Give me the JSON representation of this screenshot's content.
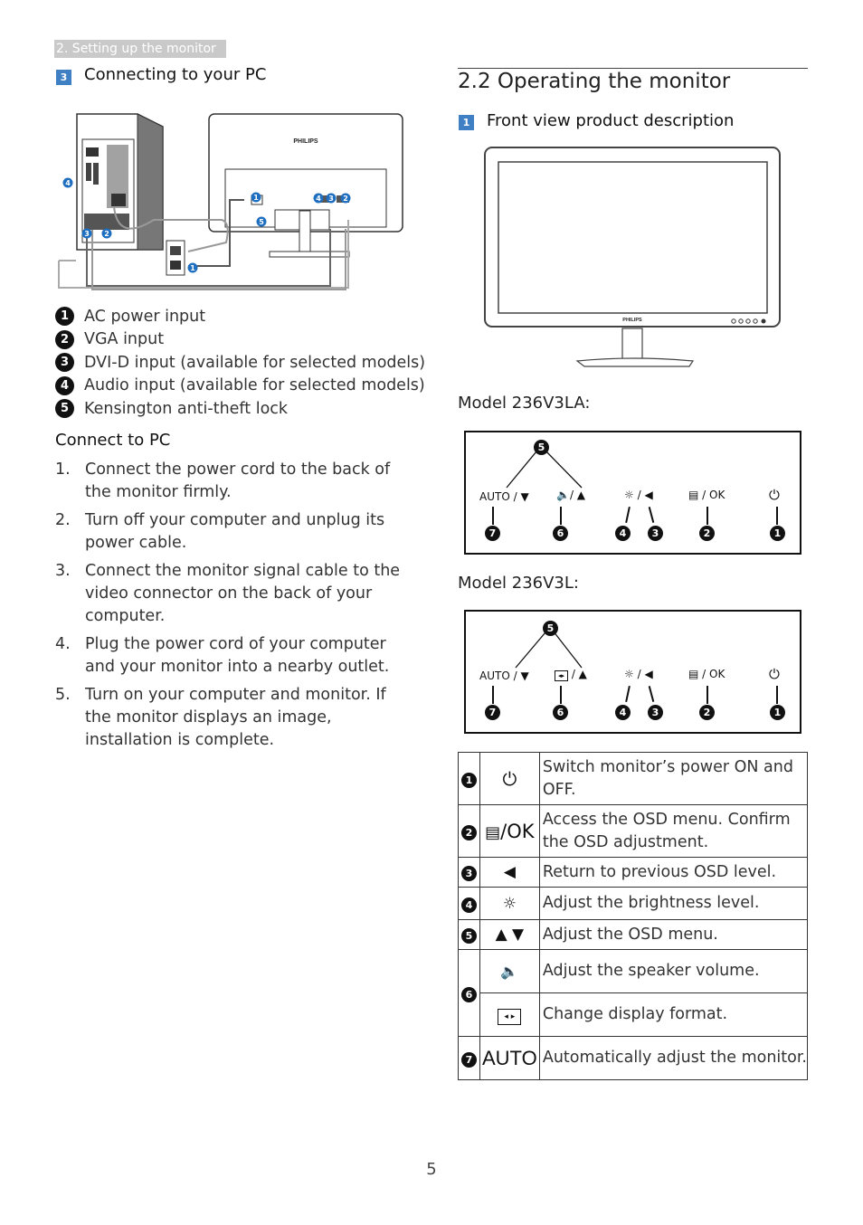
{
  "breadcrumb": "2. Setting up the monitor",
  "left": {
    "section_number": "3",
    "section_title": "Connecting to your PC",
    "diagram": {
      "brand": "PHILIPS",
      "callouts": [
        "1",
        "2",
        "3",
        "4",
        "5"
      ]
    },
    "legend": [
      {
        "num": "1",
        "text": "AC power input"
      },
      {
        "num": "2",
        "text": "VGA input"
      },
      {
        "num": "3",
        "text": "DVI-D input (available for selected models)"
      },
      {
        "num": "4",
        "text": "Audio input (available for selected models)"
      },
      {
        "num": "5",
        "text": "Kensington anti-theft lock"
      }
    ],
    "connect_heading": "Connect to PC",
    "steps": [
      {
        "num": "1.",
        "text": "Connect the power cord to the back of the monitor firmly."
      },
      {
        "num": "2.",
        "text": "Turn off your computer and unplug its power cable."
      },
      {
        "num": "3.",
        "text": "Connect the monitor signal cable to the video connector on the back of your computer."
      },
      {
        "num": "4.",
        "text": "Plug the power cord of your computer and your monitor into a nearby outlet."
      },
      {
        "num": "5.",
        "text": "Turn on your computer and monitor. If the monitor displays an image,  installation is complete."
      }
    ]
  },
  "right": {
    "chapter_title": "2.2  Operating the monitor",
    "section_number": "1",
    "section_title": "Front view product description",
    "monitor_brand": "PHILIPS",
    "models": [
      {
        "label": "Model 236V3LA:",
        "buttons": [
          "AUTO / ▼",
          "🔈/ ▲",
          "☼ / ◀",
          "▤ / OK",
          "⏻"
        ],
        "button6_icon": "speaker-icon",
        "numbers": [
          "5",
          "7",
          "6",
          "4",
          "3",
          "2",
          "1"
        ]
      },
      {
        "label": "Model 236V3L:",
        "buttons": [
          "AUTO / ▼",
          "format / ▲",
          "☼ / ◀",
          "▤ / OK",
          "⏻"
        ],
        "button6_icon": "display-format-icon",
        "numbers": [
          "5",
          "7",
          "6",
          "4",
          "3",
          "2",
          "1"
        ]
      }
    ],
    "key_table": [
      {
        "num": "1",
        "icon": "power-icon",
        "symbol": "⏻",
        "desc": "Switch monitor’s power ON and OFF."
      },
      {
        "num": "2",
        "icon": "menu-ok-icon",
        "symbol": "/OK",
        "desc": "Access the OSD menu. Confirm the OSD adjustment."
      },
      {
        "num": "3",
        "icon": "left-triangle-icon",
        "symbol": "◀",
        "desc": "Return to previous OSD level."
      },
      {
        "num": "4",
        "icon": "brightness-icon",
        "symbol": "☼",
        "desc": "Adjust the brightness level."
      },
      {
        "num": "5",
        "icon": "up-down-icon",
        "symbol": "▲ ▼",
        "desc": "Adjust the OSD menu."
      },
      {
        "num": "6",
        "icon": "speaker-icon",
        "symbol": "",
        "desc": "Adjust the speaker volume."
      },
      {
        "num": "",
        "icon": "display-format-icon",
        "symbol": "",
        "desc": "Change display format."
      },
      {
        "num": "7",
        "icon": "auto-icon",
        "symbol": "AUTO",
        "desc": "Automatically adjust the monitor."
      }
    ]
  },
  "page_number": "5"
}
